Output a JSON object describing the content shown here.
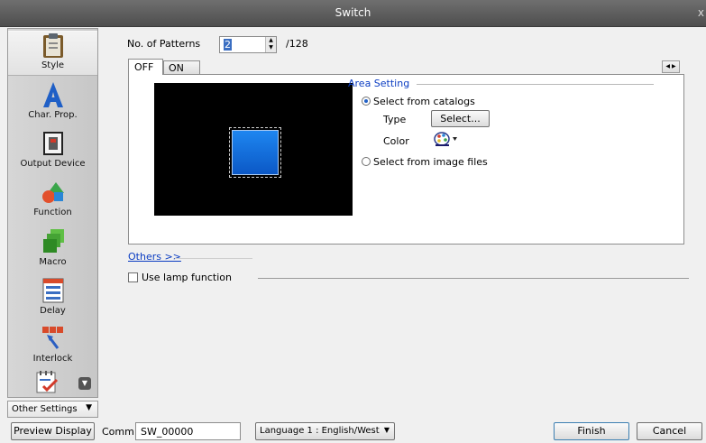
{
  "window": {
    "title": "Switch",
    "close_glyph": "x"
  },
  "sidebar": {
    "items": [
      {
        "id": "style",
        "label": "Style",
        "icon": "clipboard-icon"
      },
      {
        "id": "char-prop",
        "label": "Char. Prop.",
        "icon": "letter-a-icon"
      },
      {
        "id": "output-device",
        "label": "Output Device",
        "icon": "output-device-icon"
      },
      {
        "id": "function",
        "label": "Function",
        "icon": "shapes-icon"
      },
      {
        "id": "macro",
        "label": "Macro",
        "icon": "stacked-squares-icon"
      },
      {
        "id": "delay",
        "label": "Delay",
        "icon": "timer-list-icon"
      },
      {
        "id": "interlock",
        "label": "Interlock",
        "icon": "interlock-icon"
      },
      {
        "id": "more",
        "label": "",
        "icon": "checklist-icon"
      }
    ],
    "selected": "style"
  },
  "other_settings": {
    "label": "Other Settings"
  },
  "patterns": {
    "label": "No. of Patterns",
    "value": "2",
    "max": "/128"
  },
  "tabs": [
    {
      "label": "OFF",
      "active": true
    },
    {
      "label": "ON",
      "active": false
    }
  ],
  "area_setting": {
    "label": "Area Setting",
    "option_catalogs": "Select from catalogs",
    "type_label": "Type",
    "select_button": "Select...",
    "color_label": "Color",
    "option_image": "Select from image files",
    "selected_option": "catalogs"
  },
  "preview_colors": {
    "background": "#000000",
    "button": "#1e86f0"
  },
  "others_link": "Others >>",
  "lamp": {
    "label": "Use lamp function",
    "checked": false
  },
  "bottom": {
    "preview_button": "Preview Display",
    "comm_label": "Comm",
    "comm_value": "SW_00000",
    "language": "Language 1 : English/West",
    "finish_button": "Finish",
    "cancel_button": "Cancel"
  },
  "colors": {
    "link": "#0a3cc2",
    "titlebar": "#5a5a5a",
    "accent_radio": "#2261c6"
  }
}
